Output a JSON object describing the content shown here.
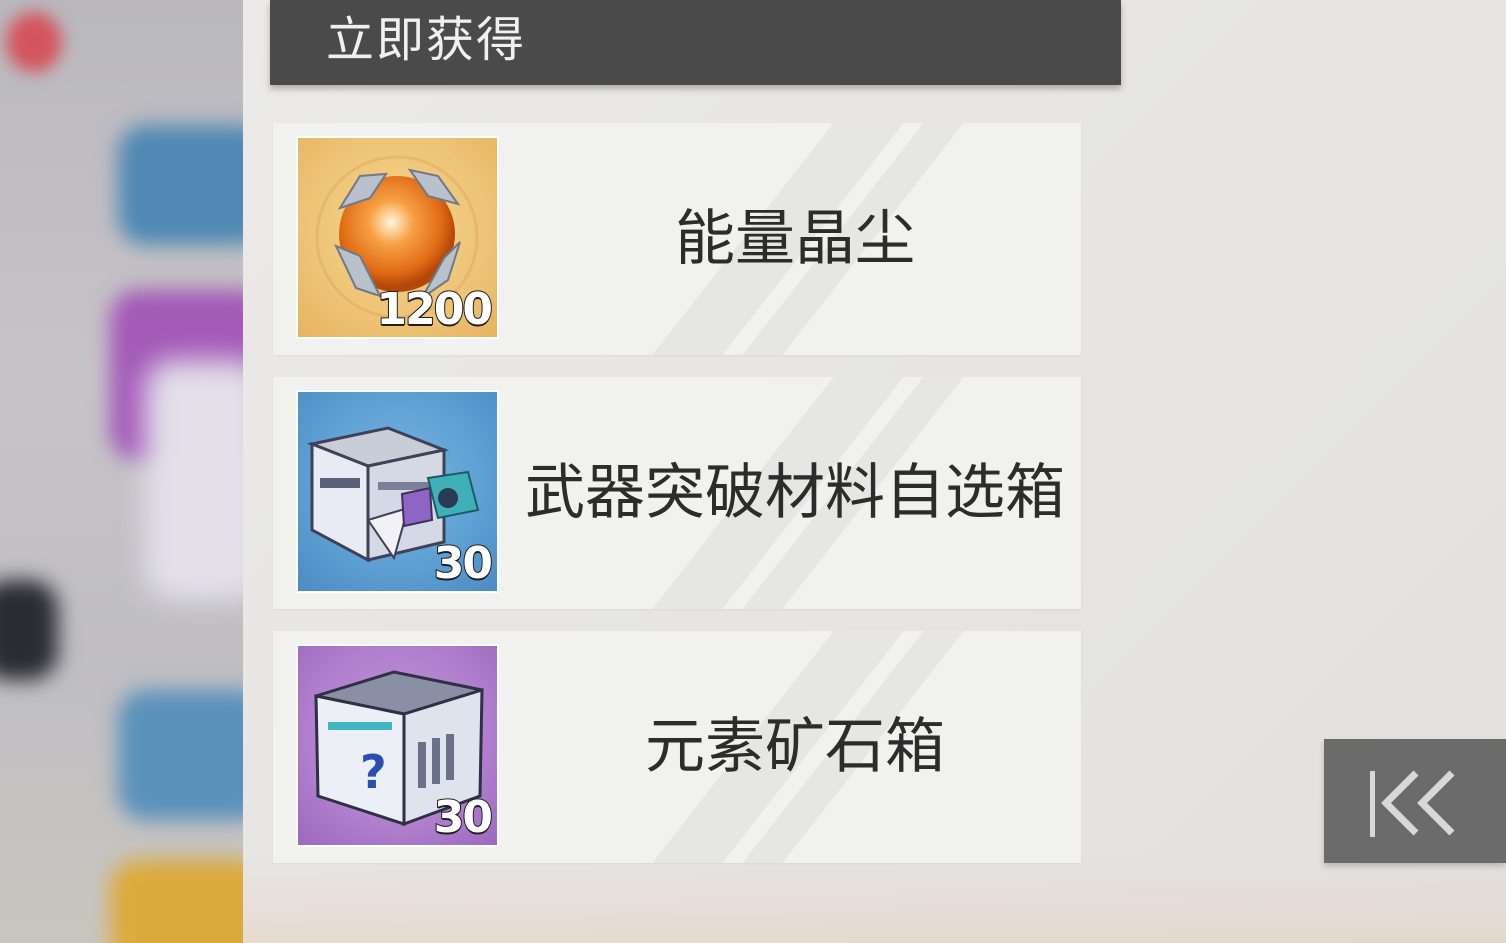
{
  "header": {
    "title": "立即获得"
  },
  "rewards": [
    {
      "name": "能量晶尘",
      "quantity": "1200",
      "icon": "energy-crystal-dust-icon",
      "rarity_color": "#eec476"
    },
    {
      "name": "武器突破材料自选箱",
      "quantity": "30",
      "icon": "weapon-breakthrough-box-icon",
      "rarity_color": "#5d9fd2"
    },
    {
      "name": "元素矿石箱",
      "quantity": "30",
      "icon": "element-ore-box-icon",
      "rarity_color": "#b07fcd"
    }
  ],
  "controls": {
    "collapse_icon": "double-chevron-left-icon"
  }
}
